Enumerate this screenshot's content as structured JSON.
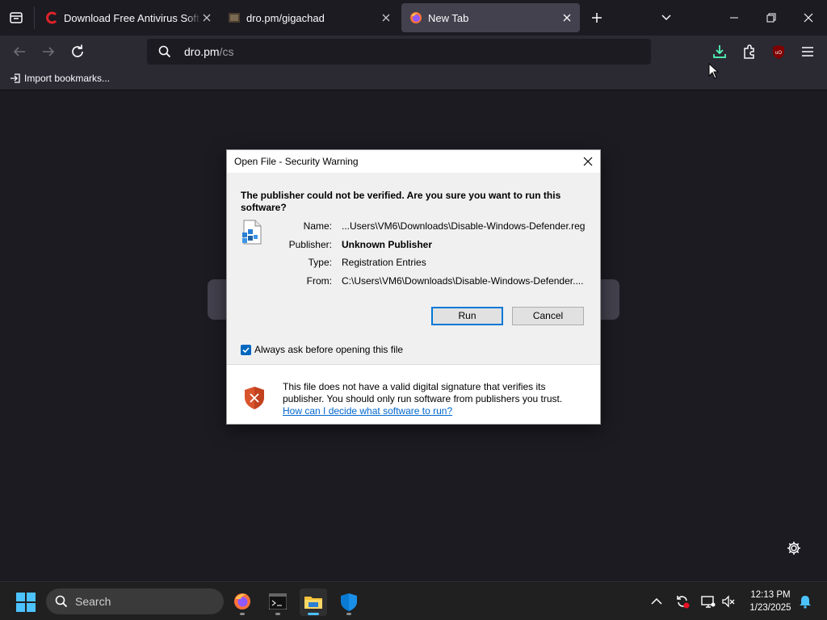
{
  "browser": {
    "tabs": [
      {
        "title": "Download Free Antivirus Software",
        "icon": "comodo-c-icon"
      },
      {
        "title": "dro.pm/gigachad",
        "icon": "image-favicon"
      },
      {
        "title": "New Tab",
        "icon": "firefox-icon",
        "active": true
      }
    ],
    "new_tab_icon": "plus-icon",
    "list_tabs_icon": "chevron-down-icon",
    "url": {
      "host": "dro.pm",
      "path": "/cs"
    },
    "bookmarks_toolbar": {
      "import_label": "Import bookmarks..."
    }
  },
  "dialog": {
    "title": "Open File - Security Warning",
    "question": "The publisher could not be verified.  Are you sure you want to run this software?",
    "props": [
      {
        "label": "Name:",
        "value": "...Users\\VM6\\Downloads\\Disable-Windows-Defender.reg",
        "bold": false
      },
      {
        "label": "Publisher:",
        "value": "Unknown Publisher",
        "bold": true
      },
      {
        "label": "Type:",
        "value": "Registration Entries",
        "bold": false
      },
      {
        "label": "From:",
        "value": "C:\\Users\\VM6\\Downloads\\Disable-Windows-Defender....",
        "bold": false
      }
    ],
    "run_label": "Run",
    "cancel_label": "Cancel",
    "always_ask_label": "Always ask before opening this file",
    "always_ask_checked": true,
    "footer_text": "This file does not have a valid digital signature that verifies its publisher.  You should only run software from publishers you trust.",
    "footer_link": "How can I decide what software to run?"
  },
  "taskbar": {
    "search_label": "Search",
    "clock_time": "12:13 PM",
    "clock_date": "1/23/2025"
  },
  "colors": {
    "accent": "#0078d7",
    "dialog_bg": "#f0f0f0",
    "browser_bg": "#1c1b22",
    "toolbar_bg": "#2b2a33",
    "download_icon": "#54ffbd"
  }
}
